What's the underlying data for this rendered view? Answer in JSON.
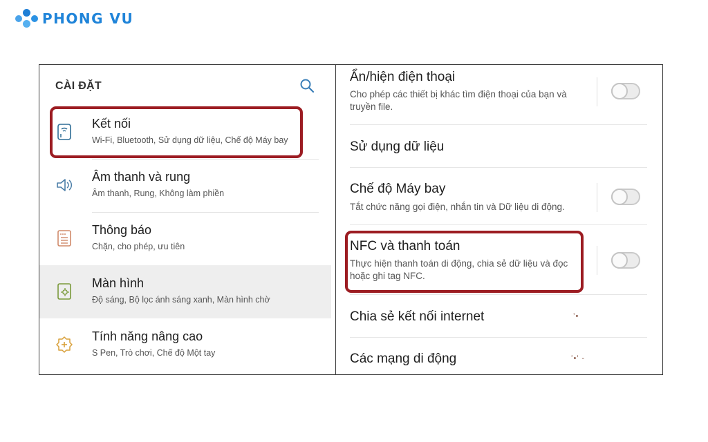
{
  "brand": {
    "name": "PHONG VU"
  },
  "left_panel": {
    "title": "CÀI ĐẶT",
    "search_icon": "search-icon",
    "items": [
      {
        "title": "Kết nối",
        "subtitle": "Wi-Fi, Bluetooth, Sử dụng dữ liệu, Chế độ Máy bay",
        "icon": "connections-icon",
        "highlighted": true
      },
      {
        "title": "Âm thanh và rung",
        "subtitle": "Âm thanh, Rung, Không làm phiền",
        "icon": "speaker-icon"
      },
      {
        "title": "Thông báo",
        "subtitle": "Chặn, cho phép, ưu tiên",
        "icon": "notifications-icon"
      },
      {
        "title": "Màn hình",
        "subtitle": "Độ sáng, Bộ lọc ánh sáng xanh, Màn hình chờ",
        "icon": "display-icon",
        "active": true
      },
      {
        "title": "Tính năng nâng cao",
        "subtitle": "S Pen, Trò chơi, Chế độ Một tay",
        "icon": "advanced-features-icon"
      }
    ]
  },
  "right_panel": {
    "items": [
      {
        "title": "Ẩn/hiện điện thoại",
        "subtitle": "Cho phép các thiết bị khác tìm điện thoại của bạn và truyền file.",
        "toggle": "off"
      },
      {
        "title": "Sử dụng dữ liệu"
      },
      {
        "title": "Chế độ Máy bay",
        "subtitle": "Tắt chức năng gọi điện, nhắn tin và Dữ liệu di động.",
        "toggle": "off"
      },
      {
        "title": "NFC và thanh toán",
        "subtitle": "Thực hiện thanh toán di động, chia sẻ dữ liệu và đọc hoặc ghi tag NFC.",
        "toggle": "off",
        "highlighted": true
      },
      {
        "title": "Chia sẻ kết nối internet"
      },
      {
        "title": "Các mạng di động"
      }
    ]
  },
  "colors": {
    "highlight": "#9c1c22",
    "brand": "#1f84d9",
    "active_row": "#eeeeee"
  }
}
